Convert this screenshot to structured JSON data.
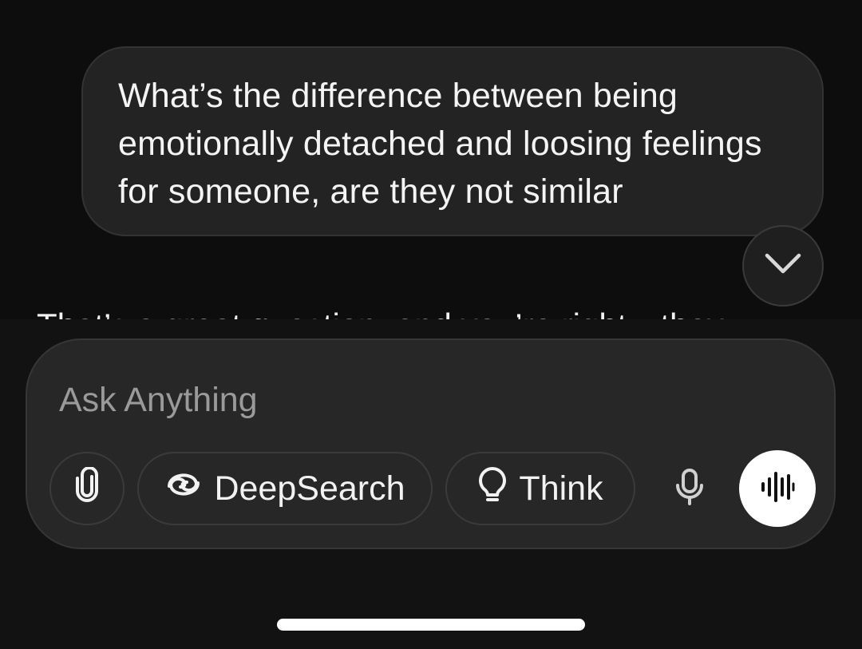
{
  "conversation": {
    "user_message": "What’s the difference between being emotionally detached and loosing feelings for someone, are they not similar",
    "assistant_message_partial": "That’s a great question, and you’re right—they"
  },
  "composer": {
    "placeholder": "Ask Anything",
    "value": "",
    "deepsearch_label": "DeepSearch",
    "think_label": "Think"
  },
  "icons": {
    "scroll_down": "chevron-down-icon",
    "attach": "paperclip-icon",
    "deepsearch": "swirl-icon",
    "think": "lightbulb-icon",
    "mic": "microphone-icon",
    "voice": "waveform-icon"
  },
  "colors": {
    "background": "#0d0d0d",
    "bubble": "#232323",
    "composer": "#272727",
    "voice_button": "#ffffff"
  }
}
